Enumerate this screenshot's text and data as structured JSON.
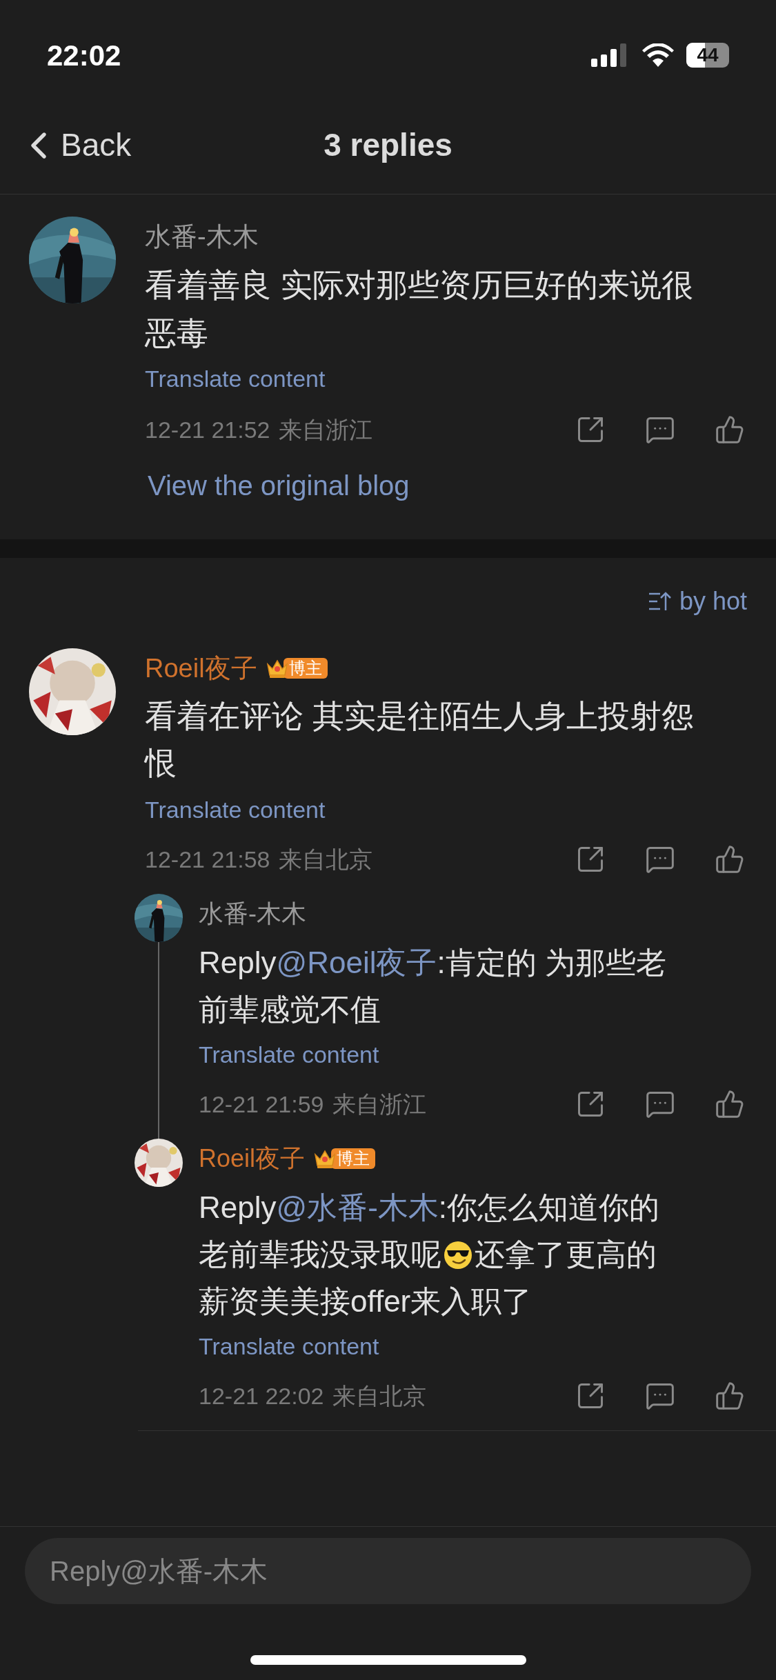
{
  "status_bar": {
    "time": "22:02",
    "battery": "44"
  },
  "nav": {
    "back": "Back",
    "title": "3 replies"
  },
  "post": {
    "author": "水番-木木",
    "is_blogger": false,
    "text": "看着善良 实际对那些资历巨好的来说很恶毒",
    "translate": "Translate content",
    "time": "12-21 21:52",
    "location": "来自浙江",
    "view_original": "View the original blog"
  },
  "sort": {
    "label": "by hot"
  },
  "comments": [
    {
      "author": "Roeil夜子",
      "is_blogger": true,
      "badge": "博主",
      "segments": [
        {
          "kind": "text",
          "text": "看着在评论 其实是往陌生人身上投射怨恨"
        }
      ],
      "translate": "Translate content",
      "time": "12-21 21:58",
      "location": "来自北京",
      "replies": [
        {
          "author": "水番-木木",
          "is_blogger": false,
          "segments": [
            {
              "kind": "text",
              "text": "Reply"
            },
            {
              "kind": "mention",
              "text": "@Roeil夜子"
            },
            {
              "kind": "text",
              "text": ":肯定的 为那些老前辈感觉不值"
            }
          ],
          "translate": "Translate content",
          "time": "12-21 21:59",
          "location": "来自浙江"
        },
        {
          "author": "Roeil夜子",
          "is_blogger": true,
          "badge": "博主",
          "segments": [
            {
              "kind": "text",
              "text": "Reply"
            },
            {
              "kind": "mention",
              "text": "@水番-木木"
            },
            {
              "kind": "text",
              "text": ":你怎么知道你的老前辈我没录取呢"
            },
            {
              "kind": "emoji"
            },
            {
              "kind": "text",
              "text": "还拿了更高的薪资美美接offer来入职了"
            }
          ],
          "translate": "Translate content",
          "time": "12-21 22:02",
          "location": "来自北京"
        }
      ]
    }
  ],
  "reply_field": {
    "placeholder": "Reply@水番-木木"
  }
}
